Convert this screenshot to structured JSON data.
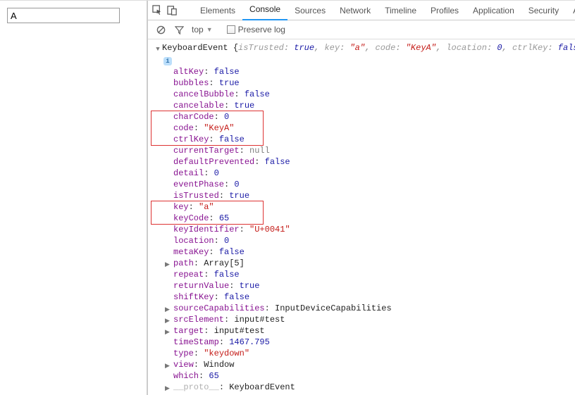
{
  "page": {
    "input_value": "A"
  },
  "tabs": {
    "elements": "Elements",
    "console": "Console",
    "sources": "Sources",
    "network": "Network",
    "timeline": "Timeline",
    "profiles": "Profiles",
    "application": "Application",
    "security": "Security",
    "audits": "Audits"
  },
  "toolbar": {
    "context": "top",
    "preserve_log": "Preserve log"
  },
  "event": {
    "class": "KeyboardEvent",
    "summary_segments": [
      {
        "k": "isTrusted",
        "t": "bool",
        "v": "true"
      },
      {
        "k": "key",
        "t": "str",
        "v": "\"a\""
      },
      {
        "k": "code",
        "t": "str",
        "v": "\"KeyA\""
      },
      {
        "k": "location",
        "t": "num",
        "v": "0"
      },
      {
        "k": "ctrlKey",
        "t": "bool",
        "v": "false…"
      }
    ],
    "props": [
      {
        "key": "altKey",
        "val": "false",
        "type": "bool"
      },
      {
        "key": "bubbles",
        "val": "true",
        "type": "bool"
      },
      {
        "key": "cancelBubble",
        "val": "false",
        "type": "bool"
      },
      {
        "key": "cancelable",
        "val": "true",
        "type": "bool"
      },
      {
        "key": "charCode",
        "val": "0",
        "type": "num"
      },
      {
        "key": "code",
        "val": "\"KeyA\"",
        "type": "str"
      },
      {
        "key": "ctrlKey",
        "val": "false",
        "type": "bool"
      },
      {
        "key": "currentTarget",
        "val": "null",
        "type": "nul"
      },
      {
        "key": "defaultPrevented",
        "val": "false",
        "type": "bool"
      },
      {
        "key": "detail",
        "val": "0",
        "type": "num"
      },
      {
        "key": "eventPhase",
        "val": "0",
        "type": "num"
      },
      {
        "key": "isTrusted",
        "val": "true",
        "type": "bool"
      },
      {
        "key": "key",
        "val": "\"a\"",
        "type": "str"
      },
      {
        "key": "keyCode",
        "val": "65",
        "type": "num"
      },
      {
        "key": "keyIdentifier",
        "val": "\"U+0041\"",
        "type": "str"
      },
      {
        "key": "location",
        "val": "0",
        "type": "num"
      },
      {
        "key": "metaKey",
        "val": "false",
        "type": "bool"
      },
      {
        "key": "path",
        "val": "Array[5]",
        "type": "obj",
        "expandable": true
      },
      {
        "key": "repeat",
        "val": "false",
        "type": "bool"
      },
      {
        "key": "returnValue",
        "val": "true",
        "type": "bool"
      },
      {
        "key": "shiftKey",
        "val": "false",
        "type": "bool"
      },
      {
        "key": "sourceCapabilities",
        "val": "InputDeviceCapabilities",
        "type": "obj",
        "expandable": true
      },
      {
        "key": "srcElement",
        "val": "input#test",
        "type": "obj",
        "expandable": true
      },
      {
        "key": "target",
        "val": "input#test",
        "type": "obj",
        "expandable": true
      },
      {
        "key": "timeStamp",
        "val": "1467.795",
        "type": "num"
      },
      {
        "key": "type",
        "val": "\"keydown\"",
        "type": "str"
      },
      {
        "key": "view",
        "val": "Window",
        "type": "obj",
        "expandable": true
      },
      {
        "key": "which",
        "val": "65",
        "type": "num"
      },
      {
        "key": "__proto__",
        "val": "KeyboardEvent",
        "type": "obj",
        "expandable": true,
        "dim": true
      }
    ],
    "highlight_groups": [
      {
        "start": 4,
        "end": 6
      },
      {
        "start": 12,
        "end": 13
      }
    ]
  }
}
